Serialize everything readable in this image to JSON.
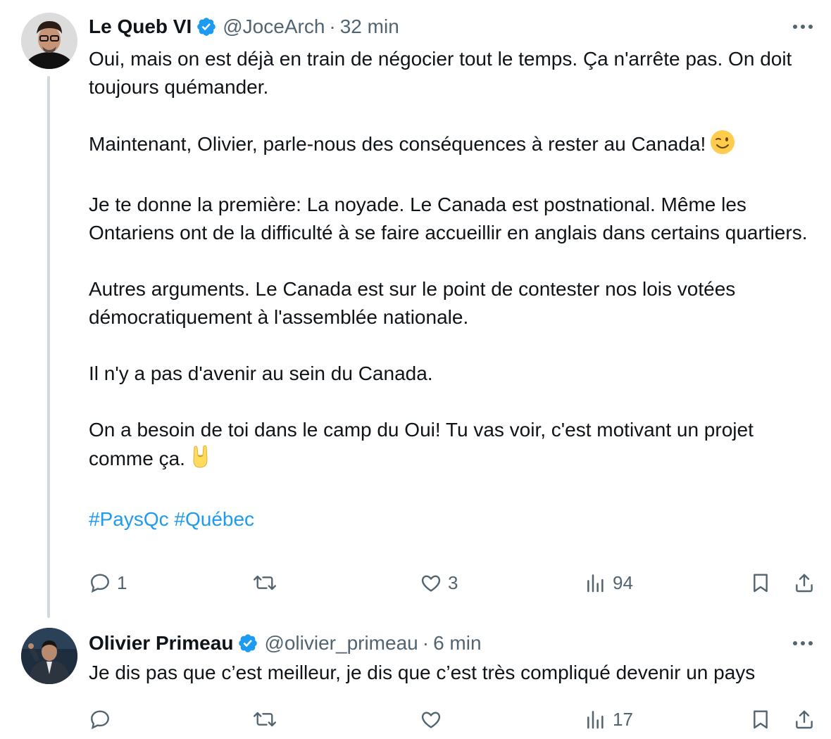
{
  "tweets": [
    {
      "author_name": "Le Queb VI",
      "handle": "@JoceArch",
      "time": "32 min",
      "paragraphs": [
        "Oui, mais on est déjà en train de négocier tout le temps. Ça n'arrête pas. On doit toujours quémander.",
        "Maintenant, Olivier, parle-nous des conséquences à rester au Canada!",
        "Je te donne la première: La noyade. Le Canada est postnational. Même les Ontariens ont de la difficulté à se faire accueillir en anglais dans certains quartiers.",
        "Autres arguments. Le Canada est sur le point de contester nos lois votées démocratiquement à l'assemblée nationale.",
        "Il n'y a pas d'avenir au sein du Canada.",
        "On a besoin de toi dans le camp du Oui! Tu vas voir, c'est motivant un projet comme ça."
      ],
      "hashtags": [
        "#PaysQc",
        "#Québec"
      ],
      "emoji_wink": "😉",
      "emoji_rock": "🤘",
      "replies": "1",
      "reposts": "",
      "likes": "3",
      "views": "94"
    },
    {
      "author_name": "Olivier Primeau",
      "handle": "@olivier_primeau",
      "time": "6 min",
      "text": "Je dis pas que c’est meilleur, je dis que c’est très compliqué devenir un pays",
      "replies": "",
      "reposts": "",
      "likes": "",
      "views": "17"
    }
  ],
  "meta_separator": "·",
  "colors": {
    "accent": "#1d9bf0",
    "muted": "#536471",
    "text": "#0f1419",
    "thread_line": "#cfd9de"
  },
  "icons": [
    "verified-badge-icon",
    "more-icon",
    "reply-icon",
    "repost-icon",
    "like-icon",
    "views-icon",
    "bookmark-icon",
    "share-icon"
  ]
}
